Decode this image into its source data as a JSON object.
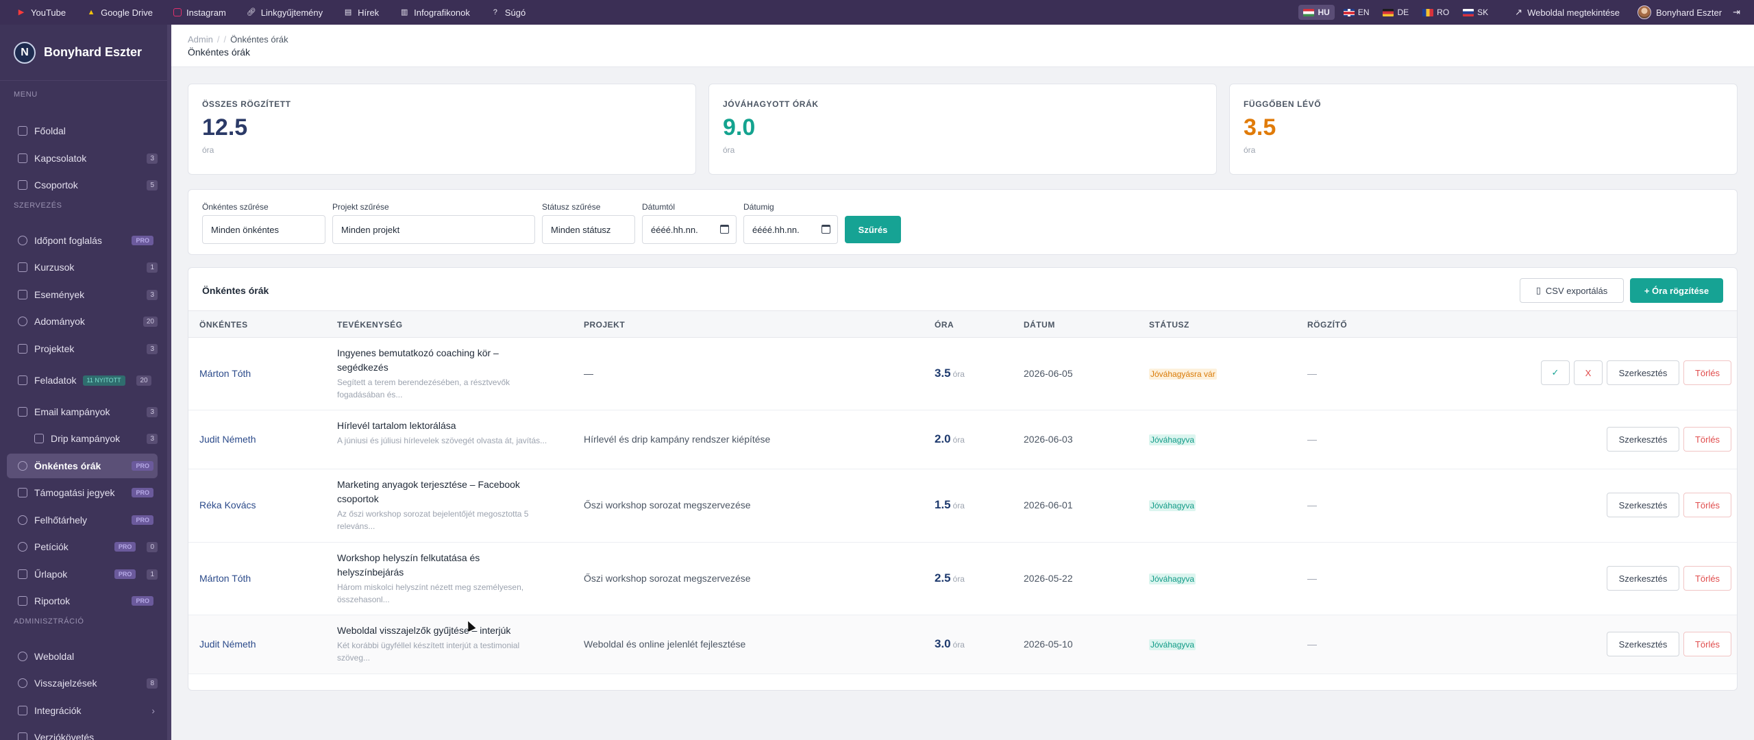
{
  "topbar": {
    "links": [
      {
        "label": "YouTube",
        "icon": "youtube-icon"
      },
      {
        "label": "Google Drive",
        "icon": "google-drive-icon"
      },
      {
        "label": "Instagram",
        "icon": "instagram-icon"
      },
      {
        "label": "Linkgyűjtemény",
        "icon": "link-icon"
      },
      {
        "label": "Hírek",
        "icon": "news-icon"
      },
      {
        "label": "Infografikonok",
        "icon": "infographic-icon"
      },
      {
        "label": "Súgó",
        "icon": "help-icon"
      }
    ],
    "languages": [
      {
        "code": "HU",
        "active": true
      },
      {
        "code": "EN",
        "active": false
      },
      {
        "code": "DE",
        "active": false
      },
      {
        "code": "RO",
        "active": false
      },
      {
        "code": "SK",
        "active": false
      }
    ],
    "view_site_label": "Weboldal megtekintése",
    "user_name": "Bonyhard Eszter",
    "colors": {
      "youtube": "#ff3b3b",
      "instagram": "#e1306c"
    }
  },
  "sidebar": {
    "brand_initial": "N",
    "brand_name": "Bonyhard Eszter",
    "sections": {
      "menu": "MENU",
      "org": "SZERVEZÉS",
      "admin": "ADMINISZTRÁCIÓ"
    },
    "items": [
      {
        "label": "Főoldal",
        "icon": "home-icon"
      },
      {
        "label": "Kapcsolatok",
        "icon": "contacts-icon",
        "count": "3"
      },
      {
        "label": "Csoportok",
        "icon": "groups-icon",
        "count": "5"
      },
      {
        "label": "Időpont foglalás",
        "icon": "clock-icon",
        "pro": "PRO"
      },
      {
        "label": "Kurzusok",
        "icon": "book-icon",
        "count": "1"
      },
      {
        "label": "Események",
        "icon": "calendar-icon",
        "count": "3"
      },
      {
        "label": "Adományok",
        "icon": "donation-icon",
        "count": "20"
      },
      {
        "label": "Projektek",
        "icon": "folder-icon",
        "count": "3"
      },
      {
        "label": "Feladatok",
        "icon": "tasks-icon",
        "new": "11 NYITOTT",
        "count": "20"
      },
      {
        "label": "Email kampányok",
        "icon": "mail-icon",
        "count": "3"
      },
      {
        "label": "Drip kampányok",
        "icon": "drip-icon",
        "count": "3"
      },
      {
        "label": "Önkéntes órák",
        "icon": "volunteer-clock-icon",
        "pro": "PRO"
      },
      {
        "label": "Támogatási jegyek",
        "icon": "ticket-icon",
        "pro": "PRO"
      },
      {
        "label": "Felhőtárhely",
        "icon": "cloud-icon",
        "pro": "PRO"
      },
      {
        "label": "Petíciók",
        "icon": "petition-icon",
        "pro": "PRO",
        "count": "0"
      },
      {
        "label": "Űrlapok",
        "icon": "form-icon",
        "pro": "PRO",
        "count": "1"
      },
      {
        "label": "Riportok",
        "icon": "report-icon",
        "pro": "PRO"
      },
      {
        "label": "Weboldal",
        "icon": "globe-icon"
      },
      {
        "label": "Visszajelzések",
        "icon": "feedback-icon",
        "count": "8"
      },
      {
        "label": "Integrációk",
        "icon": "integrations-icon",
        "chevron": "›"
      },
      {
        "label": "Verziókövetés",
        "icon": "version-icon"
      }
    ]
  },
  "breadcrumb": {
    "root": "Admin",
    "sep": "/",
    "current": "Önkéntes órák"
  },
  "page_title": "Önkéntes órák",
  "stats": [
    {
      "label": "ÖSSZES RÖGZÍTETT",
      "value": "12.5",
      "unit": "óra",
      "color": "#2b3a67"
    },
    {
      "label": "JÓVÁHAGYOTT ÓRÁK",
      "value": "9.0",
      "unit": "óra",
      "color": "#14a38f"
    },
    {
      "label": "FÜGGŐBEN LÉVŐ",
      "value": "3.5",
      "unit": "óra",
      "color": "#e07b09"
    }
  ],
  "filters": {
    "volunteer": {
      "label": "Önkéntes szűrése",
      "value": "Minden önkéntes"
    },
    "project": {
      "label": "Projekt szűrése",
      "value": "Minden projekt"
    },
    "status": {
      "label": "Státusz szűrése",
      "value": "Minden státusz"
    },
    "date_from": {
      "label": "Dátumtól",
      "value": "éééé.hh.nn."
    },
    "date_to": {
      "label": "Dátumig",
      "value": "éééé.hh.nn."
    },
    "submit_label": "Szűrés"
  },
  "table": {
    "title": "Önkéntes órák",
    "csv_label": "CSV exportálás",
    "add_label": "+ Óra rögzítése",
    "columns": [
      "ÖNKÉNTES",
      "TEVÉKENYSÉG",
      "PROJEKT",
      "ÓRA",
      "DÁTUM",
      "STÁTUSZ",
      "RÖGZÍTŐ"
    ],
    "hours_unit": "óra",
    "edit_label": "Szerkesztés",
    "delete_label": "Törlés",
    "approve_label": "✓",
    "reject_label": "X",
    "rows": [
      {
        "volunteer": "Márton Tóth",
        "activity": "Ingyenes bemutatkozó coaching kör – segédkezés",
        "desc": "Segített a terem berendezésében, a résztvevők fogadásában és...",
        "project": "—",
        "hours": "3.5",
        "date": "2026-06-05",
        "status": "Jóváhagyásra vár",
        "status_kind": "pending",
        "recorder": "—"
      },
      {
        "volunteer": "Judit Németh",
        "activity": "Hírlevél tartalom lektorálása",
        "desc": "A júniusi és júliusi hírlevelek szövegét olvasta át, javítás...",
        "project": "Hírlevél és drip kampány rendszer kiépítése",
        "hours": "2.0",
        "date": "2026-06-03",
        "status": "Jóváhagyva",
        "status_kind": "ok",
        "recorder": "—"
      },
      {
        "volunteer": "Réka Kovács",
        "activity": "Marketing anyagok terjesztése – Facebook csoportok",
        "desc": "Az őszi workshop sorozat bejelentőjét megosztotta 5 releváns...",
        "project": "Őszi workshop sorozat megszervezése",
        "hours": "1.5",
        "date": "2026-06-01",
        "status": "Jóváhagyva",
        "status_kind": "ok",
        "recorder": "—"
      },
      {
        "volunteer": "Márton Tóth",
        "activity": "Workshop helyszín felkutatása és helyszínbejárás",
        "desc": "Három miskolci helyszínt nézett meg személyesen, összehasonl...",
        "project": "Őszi workshop sorozat megszervezése",
        "hours": "2.5",
        "date": "2026-05-22",
        "status": "Jóváhagyva",
        "status_kind": "ok",
        "recorder": "—"
      },
      {
        "volunteer": "Judit Németh",
        "activity": "Weboldal visszajelzők gyűjtése – interjúk",
        "desc": "Két korábbi ügyféllel készített interjút a testimonial szöveg...",
        "project": "Weboldal és online jelenlét fejlesztése",
        "hours": "3.0",
        "date": "2026-05-10",
        "status": "Jóváhagyva",
        "status_kind": "ok",
        "recorder": "—"
      }
    ]
  }
}
